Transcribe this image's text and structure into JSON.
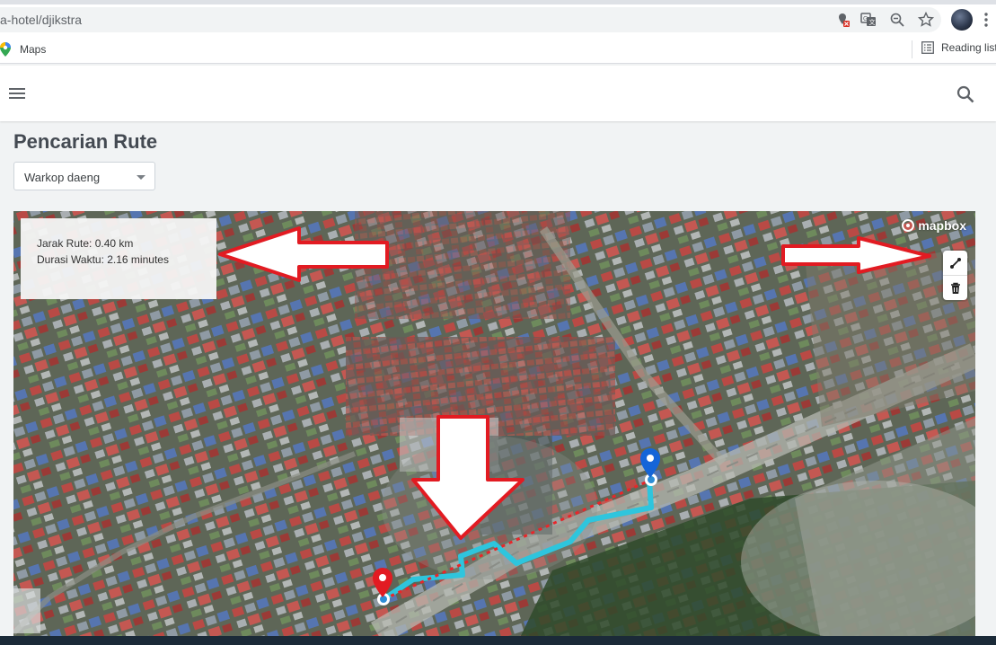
{
  "browser": {
    "url": "a-hotel/djikstra",
    "bookmark_maps_label": "Maps",
    "reading_list_label": "Reading list"
  },
  "page": {
    "title": "Pencarian Rute",
    "select_value": "Warkop daeng"
  },
  "route_info": {
    "distance": "Jarak Rute: 0.40 km",
    "duration": "Durasi Waktu: 2.16 minutes"
  },
  "map": {
    "attribution": "mapbox",
    "controls": [
      "draw-line-icon",
      "trash-icon"
    ],
    "route_color": "#2ec5dd",
    "straight_line_color": "#e8262a",
    "start_marker_color": "#e21b22",
    "end_marker_color": "#1565d8"
  },
  "annotation_arrows": {
    "color": "#e21b22",
    "count": 3
  }
}
